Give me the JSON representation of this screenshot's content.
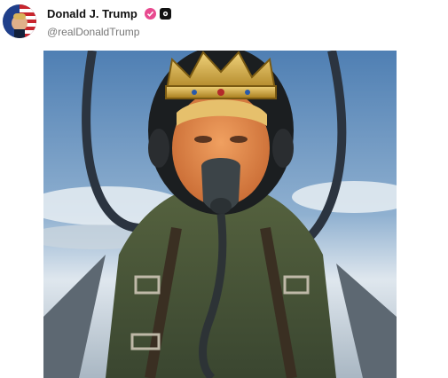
{
  "post": {
    "author": {
      "display_name": "Donald J. Trump",
      "handle": "@realDonaldTrump",
      "badges": [
        "verified-badge-icon",
        "media-badge-icon"
      ]
    },
    "media": {
      "type": "image",
      "subject": "pilot-with-crown-in-cockpit-image"
    }
  },
  "colors": {
    "verified_badge": "#e84a8f",
    "handle_text": "#777777",
    "name_text": "#111111",
    "sky": "#6a8fb5",
    "flight_suit": "#4a5a3a",
    "crown_gold": "#c9a227"
  }
}
